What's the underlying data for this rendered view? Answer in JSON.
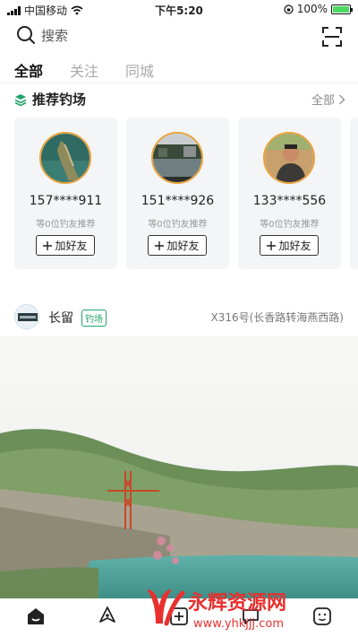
{
  "status": {
    "carrier": "中国移动",
    "time": "下午5:20",
    "battery": "100%"
  },
  "search": {
    "placeholder": "搜索"
  },
  "tabs": [
    {
      "label": "全部",
      "active": true
    },
    {
      "label": "关注",
      "active": false
    },
    {
      "label": "同城",
      "active": false
    }
  ],
  "recommend": {
    "title": "推荐钓场",
    "more": "全部",
    "cards": [
      {
        "name": "157****911",
        "subtitle": "等0位钓友推荐",
        "button": "加好友"
      },
      {
        "name": "151****926",
        "subtitle": "等0位钓友推荐",
        "button": "加好友"
      },
      {
        "name": "133****556",
        "subtitle": "等0位钓友推荐",
        "button": "加好友"
      }
    ]
  },
  "post": {
    "name": "长留",
    "tag": "钓场",
    "location": "X316号(长香路转海燕西路)"
  },
  "watermark": {
    "brand": "永辉资源网",
    "url": "www.yhkjjj.com"
  },
  "colors": {
    "accent": "#21a56a",
    "avatar_border": "#e9a23b",
    "card_bg": "#f4f5f6"
  }
}
